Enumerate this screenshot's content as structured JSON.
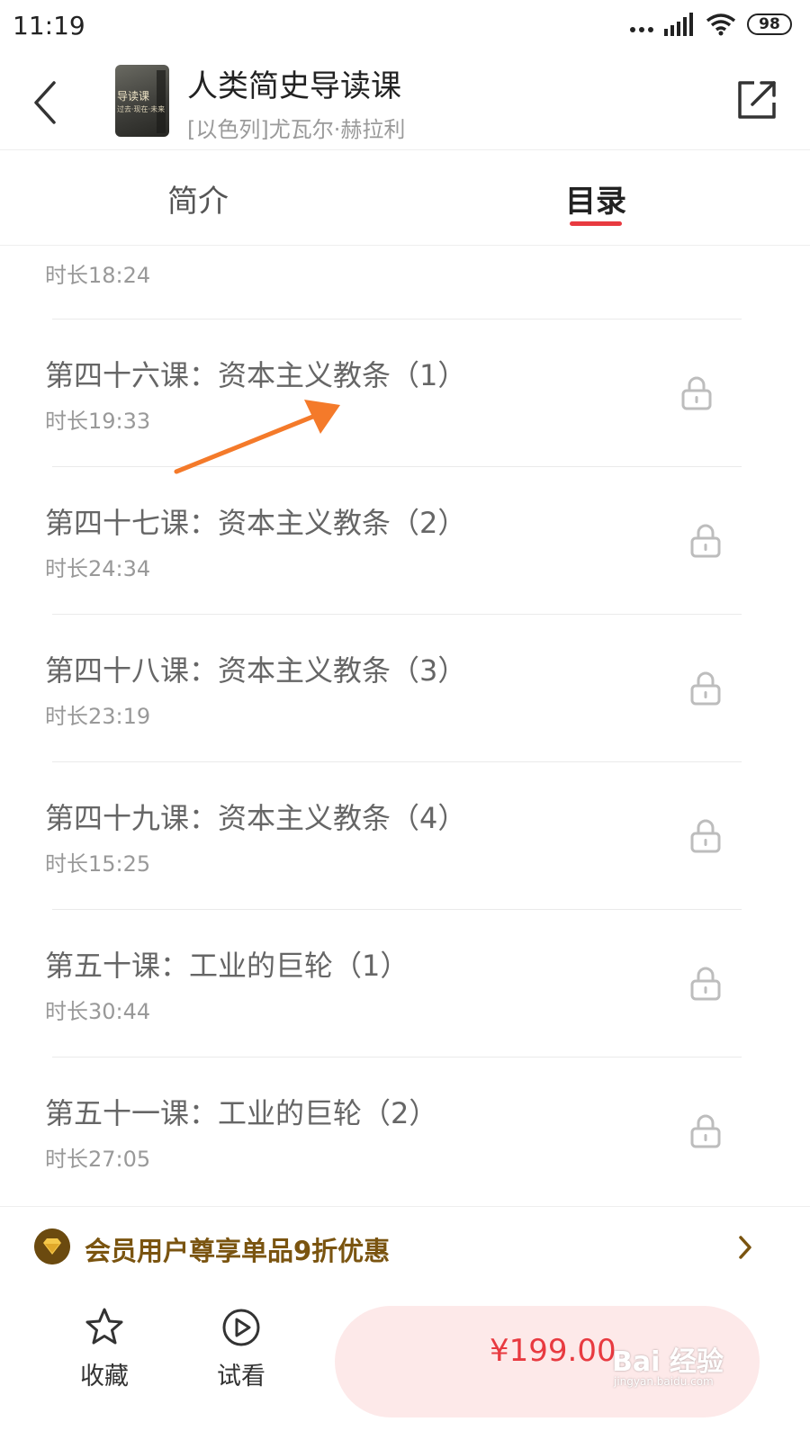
{
  "status_bar": {
    "time": "11:19",
    "battery": "98"
  },
  "header": {
    "title": "人类简史导读课",
    "author": "[以色列]尤瓦尔·赫拉利",
    "cover_text_1": "导读课",
    "cover_text_2": "过去·现在·未来"
  },
  "tabs": {
    "intro": "简介",
    "catalog": "目录",
    "active": "catalog"
  },
  "list": {
    "partial_duration": "时长18:24",
    "lessons": [
      {
        "title": "第四十六课：资本主义教条（1）",
        "duration": "时长19:33",
        "locked": true
      },
      {
        "title": "第四十七课：资本主义教条（2）",
        "duration": "时长24:34",
        "locked": true
      },
      {
        "title": "第四十八课：资本主义教条（3）",
        "duration": "时长23:19",
        "locked": true
      },
      {
        "title": "第四十九课：资本主义教条（4）",
        "duration": "时长15:25",
        "locked": true
      },
      {
        "title": "第五十课：工业的巨轮（1）",
        "duration": "时长30:44",
        "locked": true
      },
      {
        "title": "第五十一课：工业的巨轮（2）",
        "duration": "时长27:05",
        "locked": true
      }
    ]
  },
  "member_banner": {
    "text": "会员用户尊享单品9折优惠"
  },
  "bottom_bar": {
    "favorite_label": "收藏",
    "trial_label": "试看",
    "price": "¥199.00"
  },
  "watermark": {
    "main": "Bai 经验",
    "url": "jingyan.baidu.com"
  },
  "colors": {
    "accent": "#e83a40",
    "buy_button_bg": "#fde9e9",
    "member_text": "#7a5410",
    "annotation_arrow": "#f47a2a"
  }
}
